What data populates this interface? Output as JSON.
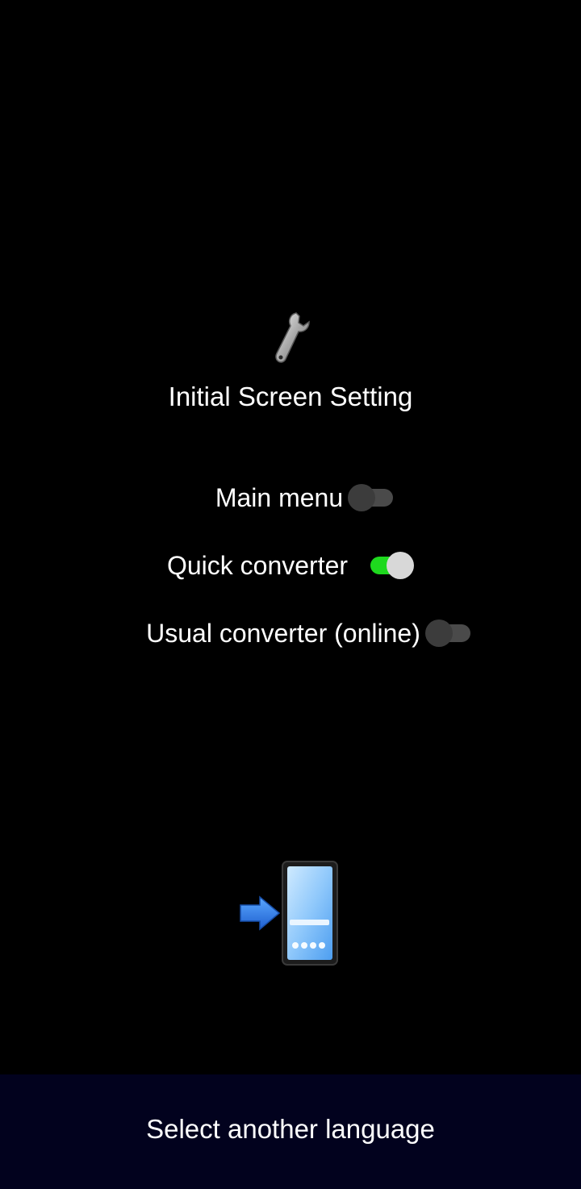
{
  "header": {
    "icon": "wrench-icon",
    "title": "Initial Screen Setting"
  },
  "options": [
    {
      "label": "Main menu",
      "enabled": false
    },
    {
      "label": "Quick converter",
      "enabled": true
    },
    {
      "label": "Usual converter (online)",
      "enabled": false
    }
  ],
  "illustration": {
    "icon": "phone-arrow-icon"
  },
  "footer": {
    "button_label": "Select another language"
  },
  "colors": {
    "background": "#000000",
    "toggle_on": "#1ed91e",
    "toggle_off": "#4a4a4a",
    "footer_bar": "#02021e"
  }
}
